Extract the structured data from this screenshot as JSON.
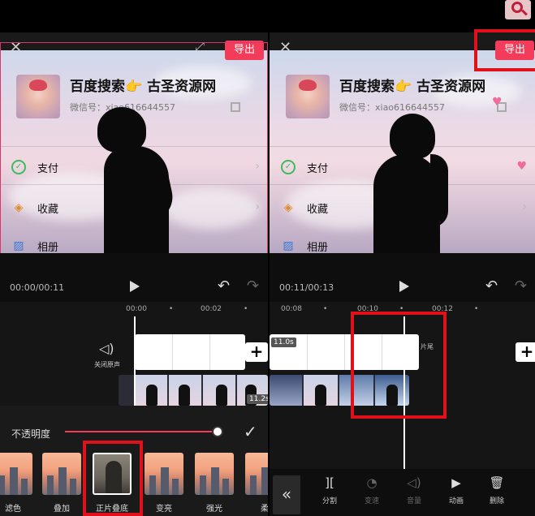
{
  "left": {
    "export_label": "导出",
    "card": {
      "name": "百度搜索👉 古圣资源网",
      "wechat": "微信号：xiao616644557"
    },
    "menu": [
      {
        "icon": "✓",
        "label": "支付"
      },
      {
        "icon": "◈",
        "label": "收藏"
      },
      {
        "icon": "▨",
        "label": "相册"
      }
    ],
    "time": "00:00/00:11",
    "ruler": [
      "00:00",
      "00:02"
    ],
    "mute_label": "关闭原声",
    "clip_duration": "11.2s",
    "opacity_label": "不透明度",
    "filters": [
      "滤色",
      "叠加",
      "正片叠底",
      "变亮",
      "强光",
      "柔"
    ]
  },
  "right": {
    "export_label": "导出",
    "card": {
      "name": "百度搜索👉 古圣资源网",
      "wechat": "微信号：xiao616644557"
    },
    "menu": [
      {
        "icon": "✓",
        "label": "支付"
      },
      {
        "icon": "◈",
        "label": "收藏"
      },
      {
        "icon": "▨",
        "label": "相册"
      }
    ],
    "time": "00:11/00:13",
    "ruler": [
      "00:08",
      "00:10",
      "00:12"
    ],
    "audio_duration": "11.0s",
    "end_label": "片尾",
    "tools": [
      {
        "icon": "][",
        "label": "分割"
      },
      {
        "icon": "◔",
        "label": "变速"
      },
      {
        "icon": "◁)",
        "label": "音量"
      },
      {
        "icon": "▶",
        "label": "动画"
      },
      {
        "icon": "🗑",
        "label": "删除"
      }
    ],
    "collapse_icon": "«"
  },
  "colors": {
    "accent": "#f23c5a",
    "highlight_box": "#e0111a",
    "background": "#000000"
  }
}
